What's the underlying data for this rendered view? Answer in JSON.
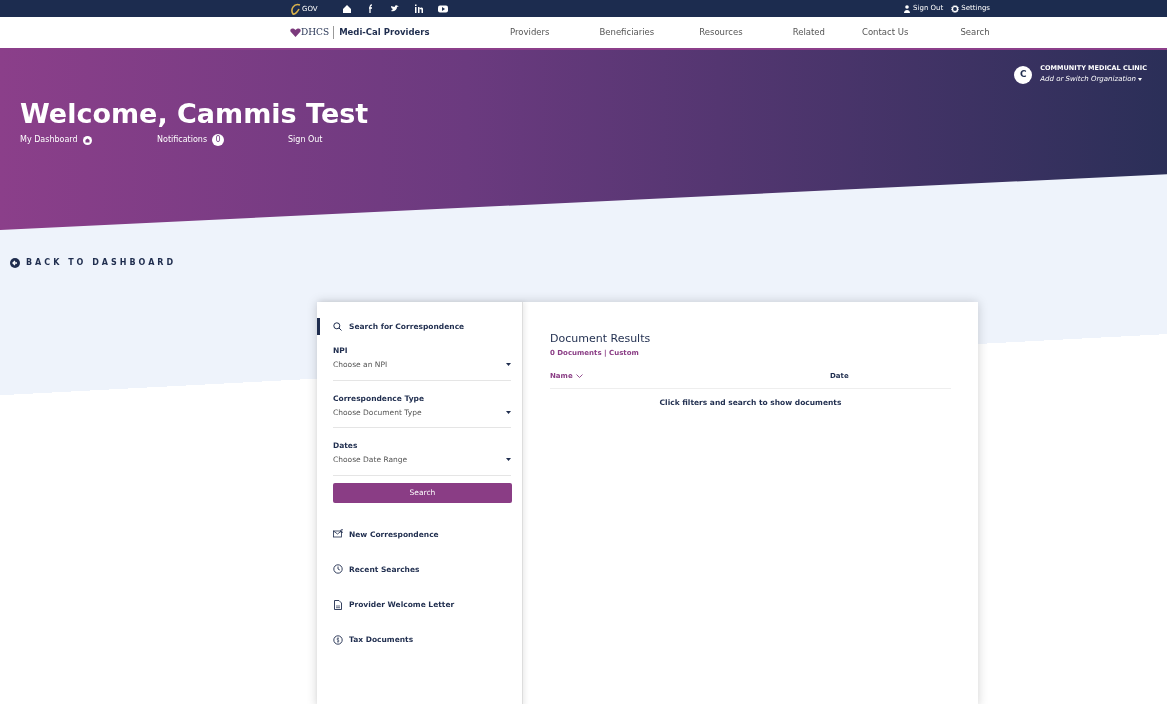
{
  "top_bar": {
    "gov_logo": "GOV",
    "links": [
      "Sign Out",
      "Settings"
    ]
  },
  "nav": {
    "brand_logo": "DHCS",
    "brand_title": "Medi-Cal Providers",
    "links": [
      "Providers",
      "Beneficiaries",
      "Resources",
      "Related",
      "Contact Us",
      "Search"
    ]
  },
  "hero": {
    "title": "Welcome, Cammis Test",
    "links": [
      {
        "label": "My Dashboard",
        "kind": "icon"
      },
      {
        "label": "Notifications",
        "kind": "badge",
        "badge": "0"
      },
      {
        "label": "Sign Out",
        "kind": "plain"
      }
    ],
    "organization": {
      "initial": "C",
      "name": "COMMUNITY MEDICAL CLINIC",
      "switch_label": "Add or Switch Organization"
    }
  },
  "back_link": "BACK TO DASHBOARD",
  "search_panel": {
    "title": "Search for Correspondence",
    "filters": [
      {
        "label": "NPI",
        "placeholder": "Choose an NPI"
      },
      {
        "label": "Correspondence Type",
        "placeholder": "Choose Document Type"
      },
      {
        "label": "Dates",
        "placeholder": "Choose Date Range"
      }
    ],
    "button": "Search",
    "links": [
      {
        "label": "New Correspondence",
        "kind": "envelope"
      },
      {
        "label": "Recent Searches",
        "kind": "clock"
      },
      {
        "label": "Provider Welcome Letter",
        "kind": "document"
      },
      {
        "label": "Tax Documents",
        "kind": "dollar"
      }
    ]
  },
  "results": {
    "title": "Document Results",
    "summary": "0 Documents | Custom",
    "columns": [
      {
        "label": "Name",
        "sorted": true
      },
      {
        "label": "Date",
        "sorted": false
      }
    ],
    "empty_message": "Click filters and search to show documents"
  }
}
